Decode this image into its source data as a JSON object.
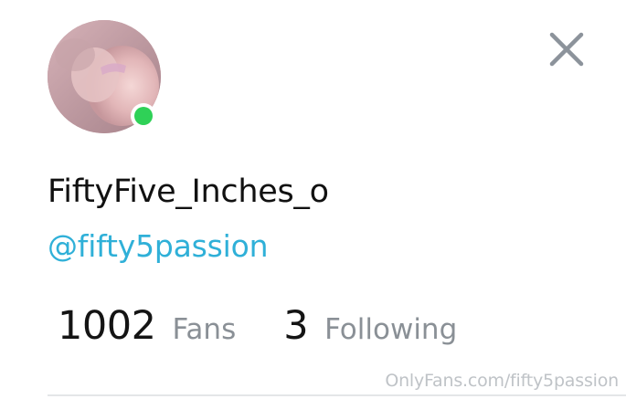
{
  "profile": {
    "display_name": "FiftyFive_Inches_o",
    "username": "@fifty5passion",
    "online": true
  },
  "stats": {
    "fans_count": "1002",
    "fans_label": "Fans",
    "following_count": "3",
    "following_label": "Following"
  },
  "watermark": "OnlyFans.com/fifty5passion",
  "colors": {
    "username": "#2fb0d8",
    "online": "#2fd157",
    "label_gray": "#8a9096",
    "close_icon": "#8c939b"
  },
  "icons": {
    "close": "close-icon",
    "online": "online-status-dot"
  }
}
